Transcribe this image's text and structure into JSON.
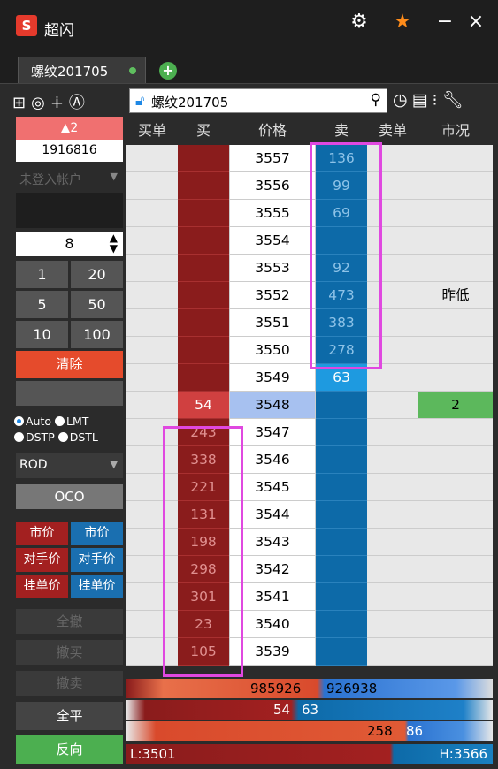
{
  "app": {
    "title": "超闪",
    "logo_text": "S"
  },
  "window_controls": {
    "settings_icon": "gear-icon",
    "star_icon": "star-icon",
    "minimize": "−",
    "close": "×"
  },
  "tabs": [
    {
      "label": "螺纹201705"
    }
  ],
  "toolbar": {
    "symbol": "螺纹201705"
  },
  "left": {
    "change": "▲2",
    "volume": "1916816",
    "account": "未登入帐户",
    "quantity": "8",
    "quick_qty": [
      "1",
      "20",
      "5",
      "50",
      "10",
      "100"
    ],
    "clear": "清除",
    "order_types": [
      "Auto",
      "LMT",
      "DSTP",
      "DSTL"
    ],
    "tif": "ROD",
    "oco": "OCO",
    "buy_market": "市价",
    "sell_market": "市价",
    "buy_counter": "对手价",
    "sell_counter": "对手价",
    "buy_queue": "挂单价",
    "sell_queue": "挂单价",
    "cancel_all": "全撤",
    "cancel_buy": "撤买",
    "cancel_sell": "撤卖",
    "flatten": "全平",
    "reverse": "反向"
  },
  "ladder": {
    "headers": [
      "买单",
      "买",
      "价格",
      "卖",
      "卖单",
      "市况"
    ],
    "rows": [
      {
        "price": "3557",
        "bid": "",
        "ask": "136",
        "mkt": ""
      },
      {
        "price": "3556",
        "bid": "",
        "ask": "99",
        "mkt": ""
      },
      {
        "price": "3555",
        "bid": "",
        "ask": "69",
        "mkt": ""
      },
      {
        "price": "3554",
        "bid": "",
        "ask": "",
        "mkt": ""
      },
      {
        "price": "3553",
        "bid": "",
        "ask": "92",
        "mkt": ""
      },
      {
        "price": "3552",
        "bid": "",
        "ask": "473",
        "mkt": "昨低"
      },
      {
        "price": "3551",
        "bid": "",
        "ask": "383",
        "mkt": ""
      },
      {
        "price": "3550",
        "bid": "",
        "ask": "278",
        "mkt": ""
      },
      {
        "price": "3549",
        "bid": "",
        "ask": "63",
        "mkt": ""
      },
      {
        "price": "3548",
        "bid": "54",
        "ask": "",
        "mkt": "2"
      },
      {
        "price": "3547",
        "bid": "243",
        "ask": "",
        "mkt": ""
      },
      {
        "price": "3546",
        "bid": "338",
        "ask": "",
        "mkt": ""
      },
      {
        "price": "3545",
        "bid": "221",
        "ask": "",
        "mkt": ""
      },
      {
        "price": "3544",
        "bid": "131",
        "ask": "",
        "mkt": ""
      },
      {
        "price": "3543",
        "bid": "198",
        "ask": "",
        "mkt": ""
      },
      {
        "price": "3542",
        "bid": "298",
        "ask": "",
        "mkt": ""
      },
      {
        "price": "3541",
        "bid": "301",
        "ask": "",
        "mkt": ""
      },
      {
        "price": "3540",
        "bid": "23",
        "ask": "",
        "mkt": ""
      },
      {
        "price": "3539",
        "bid": "105",
        "ask": "",
        "mkt": ""
      }
    ]
  },
  "bottom": {
    "total_bid": "985926",
    "total_ask": "926938",
    "best_bid": "54",
    "best_ask": "63",
    "bar3_left": "258",
    "bar3_right": "86",
    "low": "L:3501",
    "high": "H:3566"
  },
  "colors": {
    "bid": "#8a1c1c",
    "ask": "#0d6aa8",
    "highlight": "#e048e0",
    "accent": "#e54b2c"
  }
}
